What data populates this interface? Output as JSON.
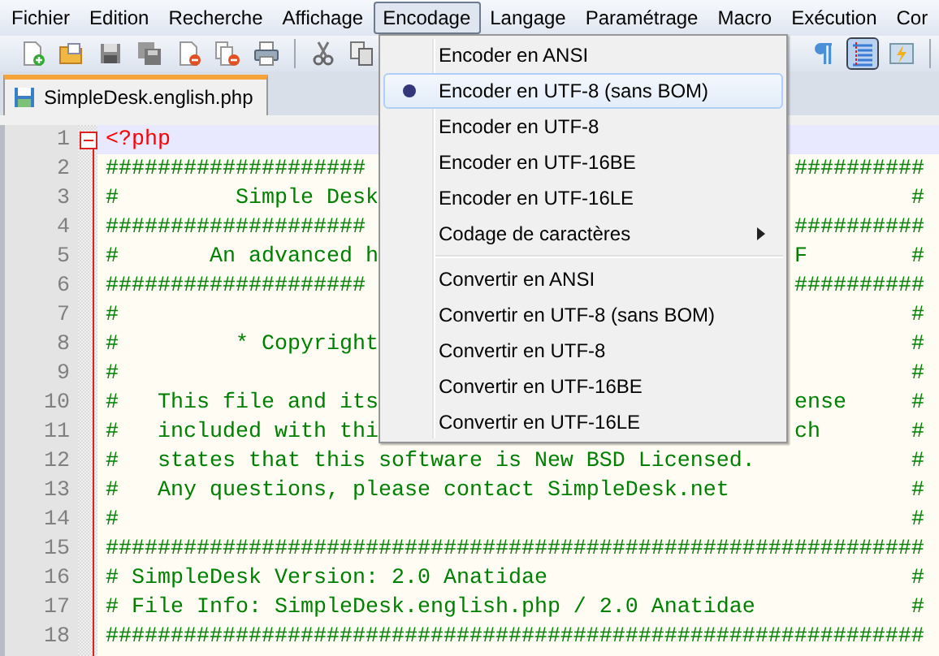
{
  "menu_bar": [
    {
      "label": "Fichier",
      "selected": false
    },
    {
      "label": "Edition",
      "selected": false
    },
    {
      "label": "Recherche",
      "selected": false
    },
    {
      "label": "Affichage",
      "selected": false
    },
    {
      "label": "Encodage",
      "selected": true
    },
    {
      "label": "Langage",
      "selected": false
    },
    {
      "label": "Paramétrage",
      "selected": false
    },
    {
      "label": "Macro",
      "selected": false
    },
    {
      "label": "Exécution",
      "selected": false
    },
    {
      "label": "Cor",
      "selected": false
    }
  ],
  "toolbar_left": [
    {
      "kind": "new",
      "on": false
    },
    {
      "kind": "open",
      "on": false
    },
    {
      "kind": "save",
      "on": false
    },
    {
      "kind": "save-all",
      "on": false
    },
    {
      "kind": "close",
      "on": false
    },
    {
      "kind": "close-all",
      "on": false
    },
    {
      "kind": "print",
      "on": false
    },
    {
      "kind": "separator"
    },
    {
      "kind": "cut",
      "on": false
    },
    {
      "kind": "copy",
      "on": false
    }
  ],
  "toolbar_right": [
    {
      "kind": "pilcrow",
      "on": false
    },
    {
      "kind": "indent-guide",
      "on": true
    },
    {
      "kind": "macro",
      "on": false
    },
    {
      "kind": "separator"
    }
  ],
  "tabs": [
    {
      "label": "SimpleDesk.english.php",
      "selected": true
    }
  ],
  "editor": {
    "lines": [
      {
        "number": "1",
        "left": "<?php",
        "kind": "php-tag",
        "current": true
      },
      {
        "number": "2",
        "left": "####################",
        "right": "##########",
        "kind": "comment",
        "current": false
      },
      {
        "number": "3",
        "left": "#         Simple Desk",
        "right": "#",
        "kind": "comment",
        "current": false
      },
      {
        "number": "4",
        "left": "####################",
        "right": "##########",
        "kind": "comment",
        "current": false
      },
      {
        "number": "5",
        "left": "#       An advanced h",
        "right": "F        #",
        "kind": "comment",
        "current": false
      },
      {
        "number": "6",
        "left": "####################",
        "right": "##########",
        "kind": "comment",
        "current": false
      },
      {
        "number": "7",
        "left": "#",
        "right": "#",
        "kind": "comment",
        "current": false
      },
      {
        "number": "8",
        "left": "#         * Copyright",
        "right": "#",
        "kind": "comment",
        "current": false
      },
      {
        "number": "9",
        "left": "#",
        "right": "#",
        "kind": "comment",
        "current": false
      },
      {
        "number": "10",
        "left": "#   This file and its",
        "right": "ense     #",
        "kind": "comment",
        "current": false
      },
      {
        "number": "11",
        "left": "#   included with thi",
        "right": "ch       #",
        "kind": "comment",
        "current": false
      },
      {
        "number": "12",
        "left": "#   states that this software is New BSD Licensed.",
        "right": "#",
        "kind": "comment",
        "current": false
      },
      {
        "number": "13",
        "left": "#   Any questions, please contact SimpleDesk.net",
        "right": "#",
        "kind": "comment",
        "current": false
      },
      {
        "number": "14",
        "left": "#",
        "right": "#",
        "kind": "comment",
        "current": false
      },
      {
        "number": "15",
        "left": "###############################################################",
        "kind": "comment",
        "current": false
      },
      {
        "number": "16",
        "left": "# SimpleDesk Version: 2.0 Anatidae",
        "right": "#",
        "kind": "comment",
        "current": false
      },
      {
        "number": "17",
        "left": "# File Info: SimpleDesk.english.php / 2.0 Anatidae",
        "right": "#",
        "kind": "comment",
        "current": false
      },
      {
        "number": "18",
        "left": "###############################################################",
        "kind": "comment",
        "current": false
      }
    ]
  },
  "dropdown": {
    "items": [
      {
        "kind": "item",
        "label": "Encoder en ANSI",
        "checked": false,
        "highlighted": false
      },
      {
        "kind": "item",
        "label": "Encoder en UTF-8 (sans BOM)",
        "checked": true,
        "highlighted": true
      },
      {
        "kind": "item",
        "label": "Encoder en UTF-8",
        "checked": false,
        "highlighted": false
      },
      {
        "kind": "item",
        "label": "Encoder en UTF-16BE",
        "checked": false,
        "highlighted": false
      },
      {
        "kind": "item",
        "label": "Encoder en UTF-16LE",
        "checked": false,
        "highlighted": false
      },
      {
        "kind": "submenu",
        "label": "Codage de caractères",
        "checked": false,
        "highlighted": false
      },
      {
        "kind": "separator"
      },
      {
        "kind": "item",
        "label": "Convertir en ANSI",
        "checked": false,
        "highlighted": false
      },
      {
        "kind": "item",
        "label": "Convertir en UTF-8 (sans BOM)",
        "checked": false,
        "highlighted": false
      },
      {
        "kind": "item",
        "label": "Convertir en UTF-8",
        "checked": false,
        "highlighted": false
      },
      {
        "kind": "item",
        "label": "Convertir en UTF-16BE",
        "checked": false,
        "highlighted": false
      },
      {
        "kind": "item",
        "label": "Convertir en UTF-16LE",
        "checked": false,
        "highlighted": false
      }
    ]
  }
}
